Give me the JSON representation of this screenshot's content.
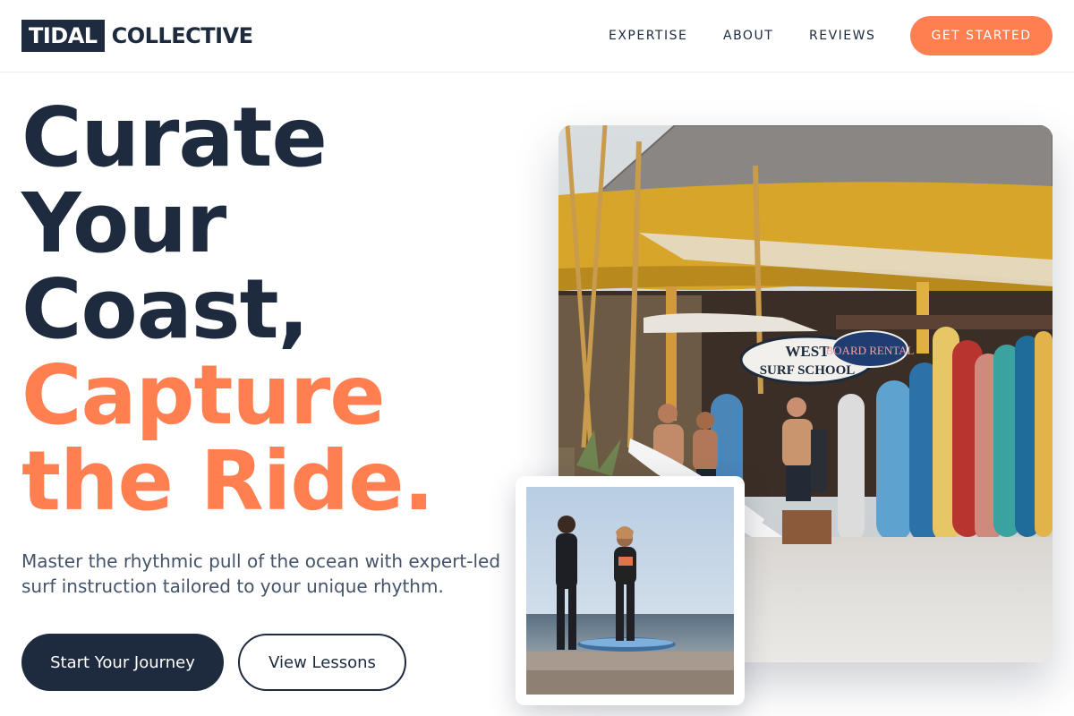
{
  "brand": {
    "box": "TIDAL",
    "text": "COLLECTIVE"
  },
  "nav": {
    "items": [
      {
        "label": "EXPERTISE"
      },
      {
        "label": "ABOUT"
      },
      {
        "label": "REVIEWS"
      }
    ],
    "cta": "GET STARTED"
  },
  "hero": {
    "line1": "Curate",
    "line2": "Your",
    "line3": "Coast,",
    "line4": "Capture",
    "line5": "the Ride.",
    "description": "Master the rhythmic pull of the ocean with expert-led surf instruction tailored to your unique rhythm.",
    "primary_button": "Start Your Journey",
    "secondary_button": "View Lessons"
  },
  "images": {
    "main": {
      "sign_text": "WEST SB SURF SCHOOL",
      "board_rental": "BOARD RENTAL"
    }
  },
  "colors": {
    "navy": "#1e2a3e",
    "accent": "#ff7f50",
    "muted": "#44536a"
  }
}
